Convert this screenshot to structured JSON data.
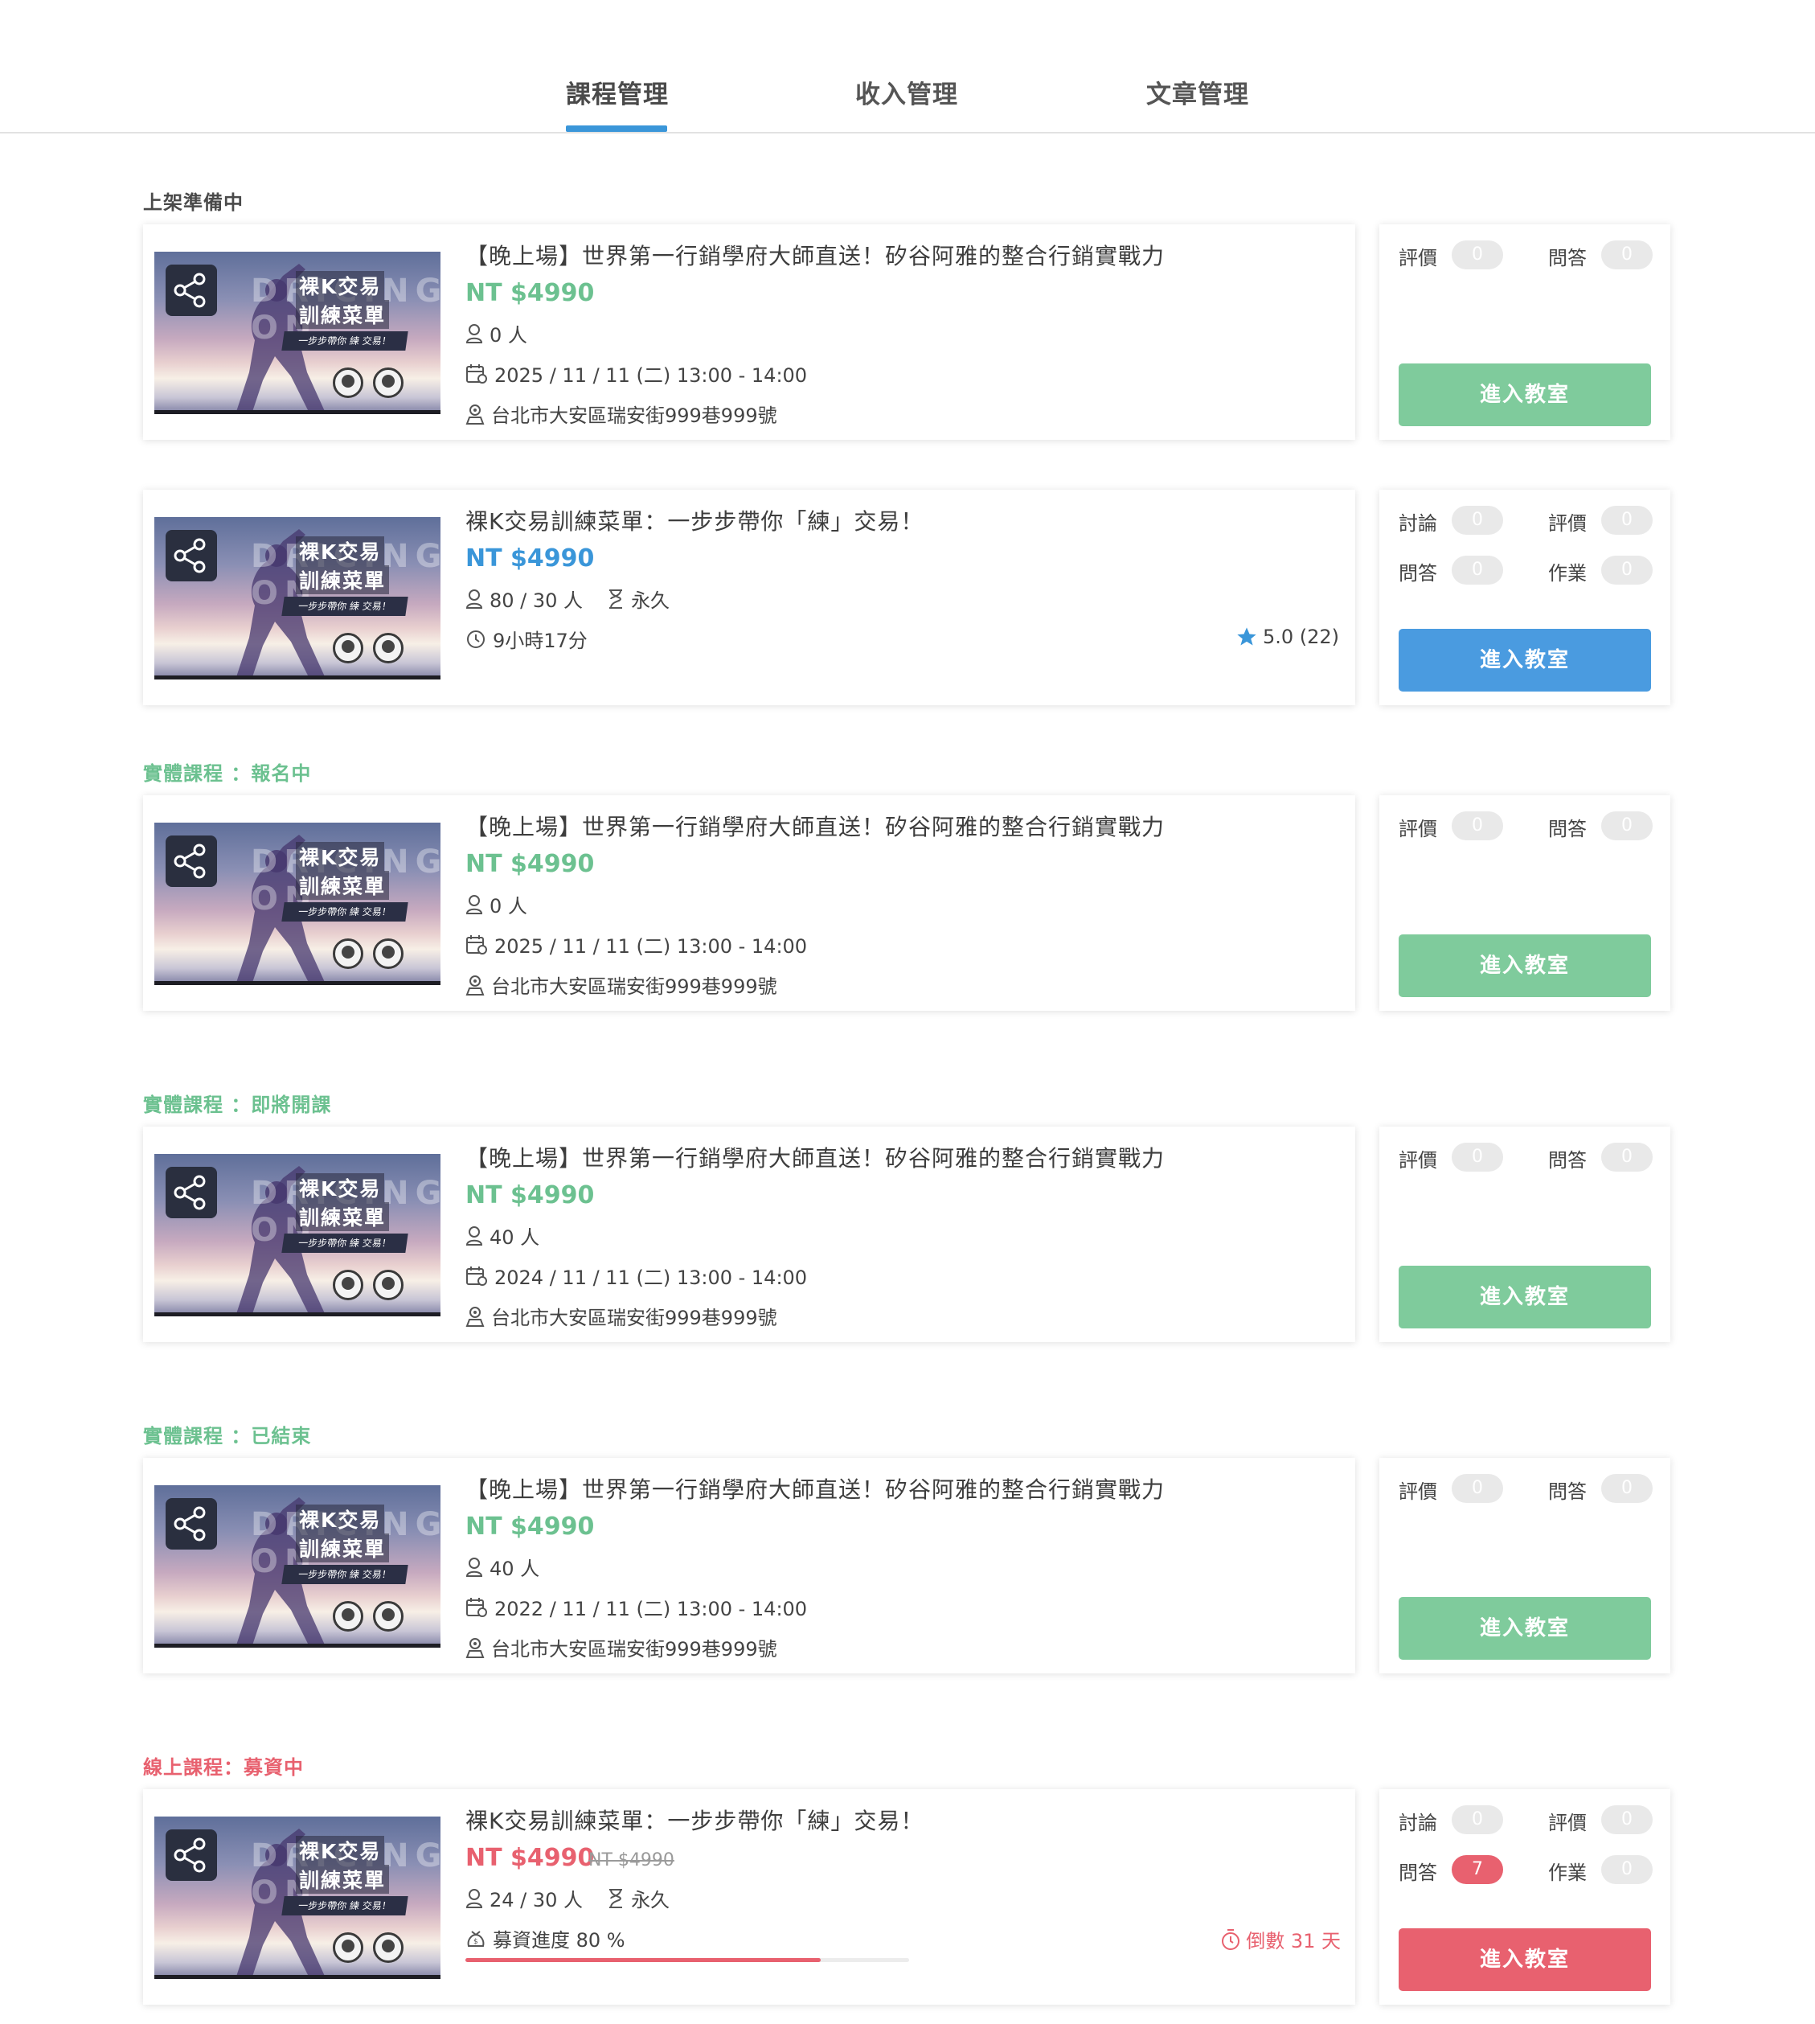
{
  "tabs": [
    {
      "label": "課程管理",
      "active": true
    },
    {
      "label": "收入管理",
      "active": false
    },
    {
      "label": "文章管理",
      "active": false
    }
  ],
  "colors": {
    "accent_blue": "#3a96d9",
    "green": "#7fcb9c",
    "red": "#e8616f",
    "pill_gray": "#e9e9e9"
  },
  "sections": [
    {
      "label": "上架準備中",
      "color": "#4a4a4a"
    },
    {
      "label": "實體課程 ：報名中",
      "color": "#6cc190"
    },
    {
      "label": "實體課程 ：即將開課",
      "color": "#6cc190"
    },
    {
      "label": "實體課程 ：已結束",
      "color": "#6cc190"
    },
    {
      "label": "線上課程：募資中",
      "color": "#e8616f"
    }
  ],
  "thumbnail": {
    "title1": "裸K交易",
    "title2": "訓練菜單",
    "slogan": "一步步帶你 練 交易！",
    "bg_text": "DRICING ON"
  },
  "cards": [
    {
      "icon": "course-thumbnail",
      "title": "【晚上場】世界第一行銷學府大師直送！矽谷阿雅的整合行銷實戰力",
      "price": "NT $4990",
      "price_color": "#6cc190",
      "people": "0 人",
      "date": "2025 / 11 / 11 (二) 13:00 - 14:00",
      "address": "台北市大安區瑞安街999巷999號",
      "stats": [
        {
          "label": "評價",
          "value": "0"
        },
        {
          "label": "問答",
          "value": "0"
        }
      ],
      "button": "進入教室",
      "button_color": "#7fcb9c"
    },
    {
      "title": "裸K交易訓練菜單：一步步帶你「練」交易！",
      "price": "NT $4990",
      "price_color": "#3a96d9",
      "people": "80 / 30 人",
      "duration_term": "永久",
      "time": "9小時17分",
      "rating": "5.0 (22)",
      "stats": [
        {
          "label": "討論",
          "value": "0"
        },
        {
          "label": "評價",
          "value": "0"
        },
        {
          "label": "問答",
          "value": "0"
        },
        {
          "label": "作業",
          "value": "0"
        }
      ],
      "button": "進入教室",
      "button_color": "#4a9be0"
    },
    {
      "title": "【晚上場】世界第一行銷學府大師直送！矽谷阿雅的整合行銷實戰力",
      "price": "NT $4990",
      "price_color": "#6cc190",
      "people": "0 人",
      "date": "2025 / 11 / 11 (二) 13:00 - 14:00",
      "address": "台北市大安區瑞安街999巷999號",
      "stats": [
        {
          "label": "評價",
          "value": "0"
        },
        {
          "label": "問答",
          "value": "0"
        }
      ],
      "button": "進入教室",
      "button_color": "#7fcb9c"
    },
    {
      "title": "【晚上場】世界第一行銷學府大師直送！矽谷阿雅的整合行銷實戰力",
      "price": "NT $4990",
      "price_color": "#6cc190",
      "people": "40 人",
      "date": "2024 / 11 / 11 (二) 13:00 - 14:00",
      "address": "台北市大安區瑞安街999巷999號",
      "stats": [
        {
          "label": "評價",
          "value": "0"
        },
        {
          "label": "問答",
          "value": "0"
        }
      ],
      "button": "進入教室",
      "button_color": "#7fcb9c"
    },
    {
      "title": "【晚上場】世界第一行銷學府大師直送！矽谷阿雅的整合行銷實戰力",
      "price": "NT $4990",
      "price_color": "#6cc190",
      "people": "40 人",
      "date": "2022 / 11 / 11 (二) 13:00 - 14:00",
      "address": "台北市大安區瑞安街999巷999號",
      "stats": [
        {
          "label": "評價",
          "value": "0"
        },
        {
          "label": "問答",
          "value": "0"
        }
      ],
      "button": "進入教室",
      "button_color": "#7fcb9c"
    },
    {
      "title": "裸K交易訓練菜單：一步步帶你「練」交易！",
      "price": "NT $4990",
      "price_color": "#e8616f",
      "old_price": "NT $4990",
      "people": "24 / 30 人",
      "duration_term": "永久",
      "funding": "募資進度 80 %",
      "funding_progress": 0.8,
      "countdown": "倒數 31 天",
      "stats": [
        {
          "label": "討論",
          "value": "0"
        },
        {
          "label": "評價",
          "value": "0"
        },
        {
          "label": "問答",
          "value": "7",
          "highlight": true
        },
        {
          "label": "作業",
          "value": "0"
        }
      ],
      "button": "進入教室",
      "button_color": "#e8616f"
    }
  ]
}
